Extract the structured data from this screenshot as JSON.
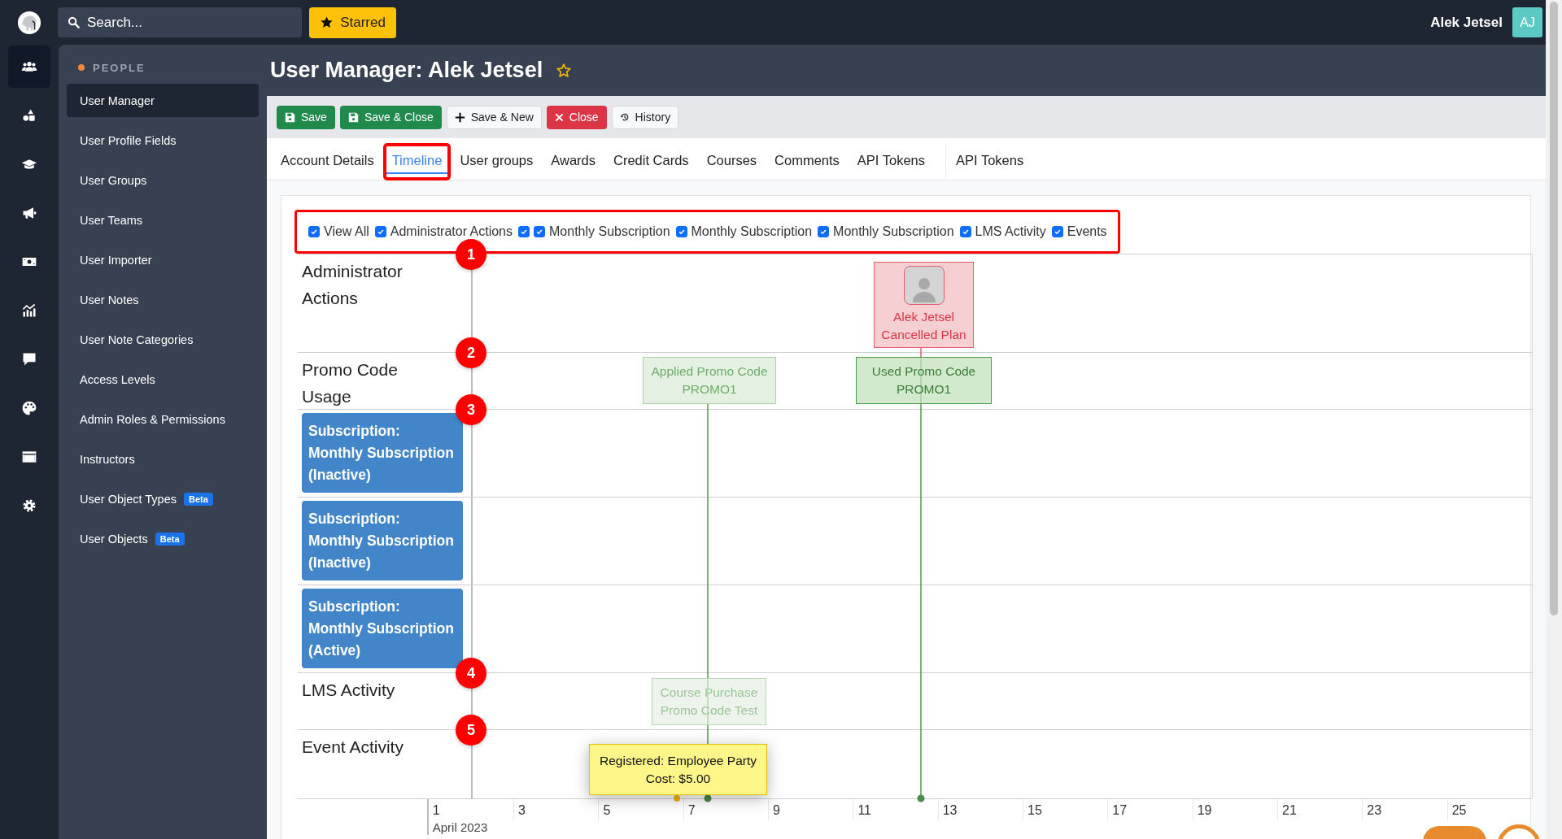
{
  "topbar": {
    "search": {
      "placeholder": "Search..."
    },
    "starred": "Starred",
    "user_name": "Alek Jetsel",
    "user_initials": "AJ"
  },
  "rail": [
    {
      "selected": true
    },
    {
      "selected": false
    },
    {
      "selected": false
    },
    {
      "selected": false
    },
    {
      "selected": false
    },
    {
      "selected": false
    },
    {
      "selected": false
    },
    {
      "selected": false
    },
    {
      "selected": false
    },
    {
      "selected": false
    }
  ],
  "sidebar": {
    "section": "PEOPLE",
    "items": [
      {
        "label": "User Manager",
        "selected": true
      },
      {
        "label": "User Profile Fields",
        "selected": false
      },
      {
        "label": "User Groups",
        "selected": false
      },
      {
        "label": "User Teams",
        "selected": false
      },
      {
        "label": "User Importer",
        "selected": false
      },
      {
        "label": "User Notes",
        "selected": false
      },
      {
        "label": "User Note Categories",
        "selected": false
      },
      {
        "label": "Access Levels",
        "selected": false
      },
      {
        "label": "Admin Roles & Permissions",
        "selected": false
      },
      {
        "label": "Instructors",
        "selected": false
      },
      {
        "label": "User Object Types",
        "selected": false,
        "badge": "Beta"
      },
      {
        "label": "User Objects",
        "selected": false,
        "badge": "Beta"
      }
    ]
  },
  "page": {
    "title": "User Manager: Alek Jetsel",
    "starred": false
  },
  "toolbar": [
    {
      "label": "Save",
      "kind": "save"
    },
    {
      "label": "Save & Close",
      "kind": "save"
    },
    {
      "label": "Save & New",
      "kind": "new"
    },
    {
      "label": "Close",
      "kind": "close"
    },
    {
      "label": "History",
      "kind": "history"
    }
  ],
  "tabs": [
    {
      "label": "Account Details",
      "selected": false,
      "highlighted": false
    },
    {
      "label": "Timeline",
      "selected": true,
      "highlighted": true
    },
    {
      "label": "User groups",
      "selected": false,
      "highlighted": false
    },
    {
      "label": "Awards",
      "selected": false,
      "highlighted": false
    },
    {
      "label": "Credit Cards",
      "selected": false,
      "highlighted": false
    },
    {
      "label": "Courses",
      "selected": false,
      "highlighted": false
    },
    {
      "label": "Comments",
      "selected": false,
      "highlighted": false
    },
    {
      "label": "API Tokens",
      "selected": false,
      "highlighted": false
    },
    {
      "label": "API Tokens",
      "selected": false,
      "highlighted": false
    }
  ],
  "filters": {
    "highlighted": true,
    "items": [
      {
        "label": "View All",
        "checked": true
      },
      {
        "label": "Administrator Actions",
        "checked": true
      },
      {
        "checked": true
      },
      {
        "label": "Monthly Subscription",
        "checked": true
      },
      {
        "label": "Monthly Subscription",
        "checked": true
      },
      {
        "label": "Monthly Subscription",
        "checked": true
      },
      {
        "label": "LMS Activity",
        "checked": true
      },
      {
        "label": "Events",
        "checked": true
      }
    ]
  },
  "rows": [
    {
      "kind": "text",
      "label": "Administrator Actions",
      "marker": "1",
      "events": [
        {
          "kind": "admin",
          "lines": [
            "Alek Jetsel",
            "Cancelled Plan"
          ]
        }
      ]
    },
    {
      "kind": "text",
      "label": "Promo Code Usage",
      "marker": "2",
      "events": [
        {
          "kind": "promo",
          "emphasis": false,
          "lines": [
            "Applied Promo Code",
            "PROMO1"
          ]
        },
        {
          "kind": "promo",
          "emphasis": true,
          "lines": [
            "Used Promo Code",
            "PROMO1"
          ]
        }
      ]
    },
    {
      "kind": "block",
      "label": "Subscription: Monthly Subscription (Inactive)",
      "marker": "3"
    },
    {
      "kind": "block",
      "label": "Subscription: Monthly Subscription (Inactive)"
    },
    {
      "kind": "block",
      "label": "Subscription: Monthly Subscription (Active)"
    },
    {
      "kind": "text",
      "label": "LMS Activity",
      "marker": "4",
      "events": [
        {
          "kind": "lms",
          "lines": [
            "Course Purchase",
            "Promo Code Test"
          ]
        }
      ]
    },
    {
      "kind": "text",
      "label": "Event Activity",
      "marker": "5",
      "events": [
        {
          "kind": "tooltip",
          "lines": [
            "Registered: Employee Party",
            "Cost: $5.00"
          ]
        }
      ]
    }
  ],
  "axis": {
    "ticks": [
      "1",
      "3",
      "5",
      "7",
      "9",
      "11",
      "13",
      "15",
      "17",
      "19",
      "21",
      "23",
      "25"
    ],
    "month": "April 2023"
  }
}
